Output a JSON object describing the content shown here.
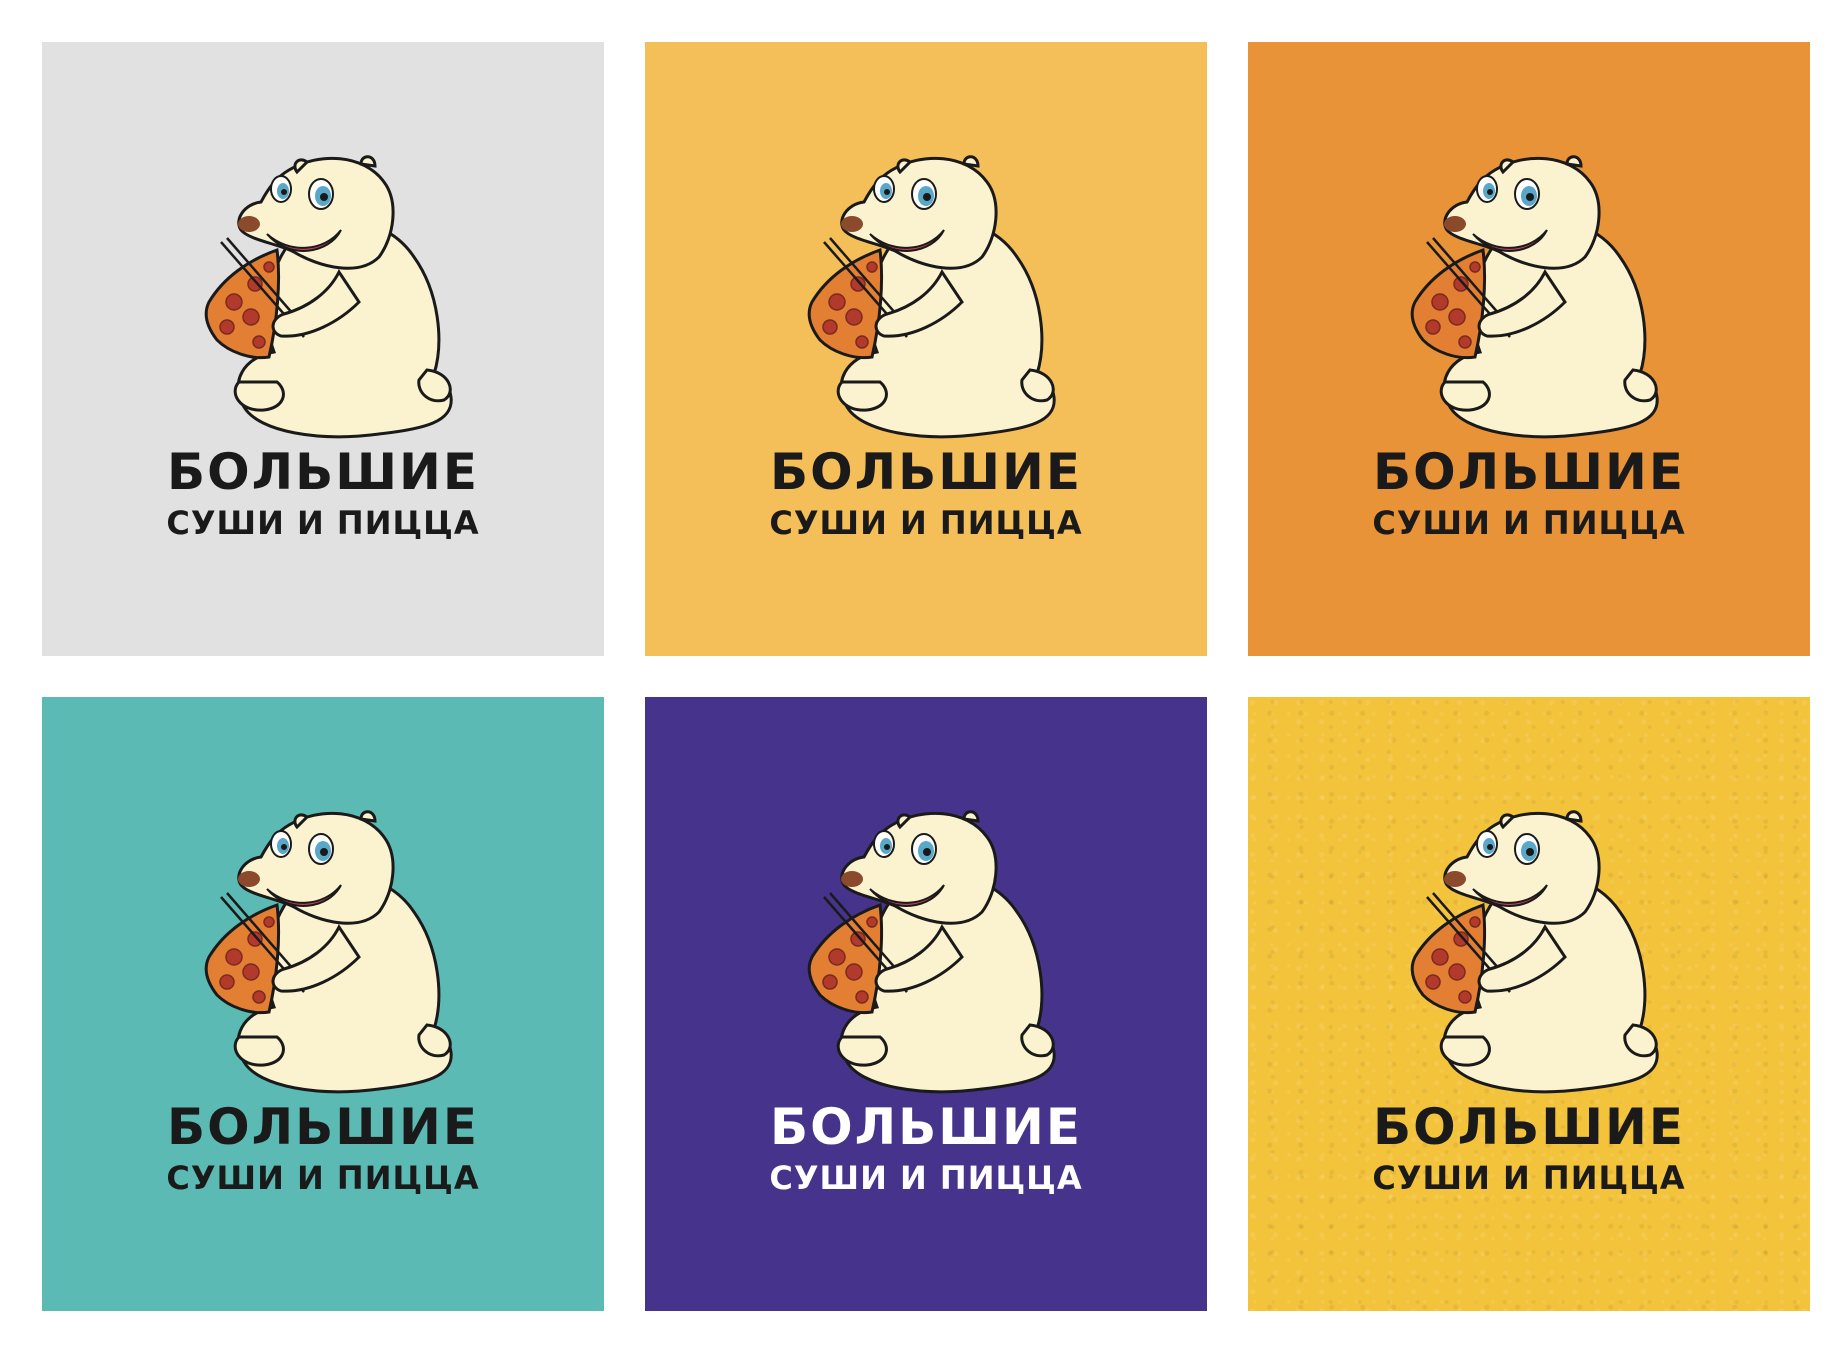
{
  "brand": {
    "line1": "БОЛЬШИЕ",
    "line2": "СУШИ И ПИЦЦА"
  },
  "tiles": [
    {
      "background": "#e1e1e1",
      "text_color": "#1a1a1a",
      "texture": false
    },
    {
      "background": "#f4be58",
      "text_color": "#1a1a1a",
      "texture": false
    },
    {
      "background": "#e89337",
      "text_color": "#1a1a1a",
      "texture": false
    },
    {
      "background": "#5cbab4",
      "text_color": "#1a1a1a",
      "texture": false
    },
    {
      "background": "#46348c",
      "text_color": "#ffffff",
      "texture": false
    },
    {
      "background": "#f3c33c",
      "text_color": "#1a1a1a",
      "texture": true
    }
  ],
  "mascot": {
    "icon": "polar-bear-with-pizza-and-chopsticks-icon",
    "fur": "#fbf2d0",
    "outline": "#1a1a1a",
    "pizza": "#e37f33",
    "pepperoni": "#b23a2c",
    "eye": "#5aa8c8",
    "mouth": "#c9415a",
    "nose": "#8c4a2c"
  }
}
